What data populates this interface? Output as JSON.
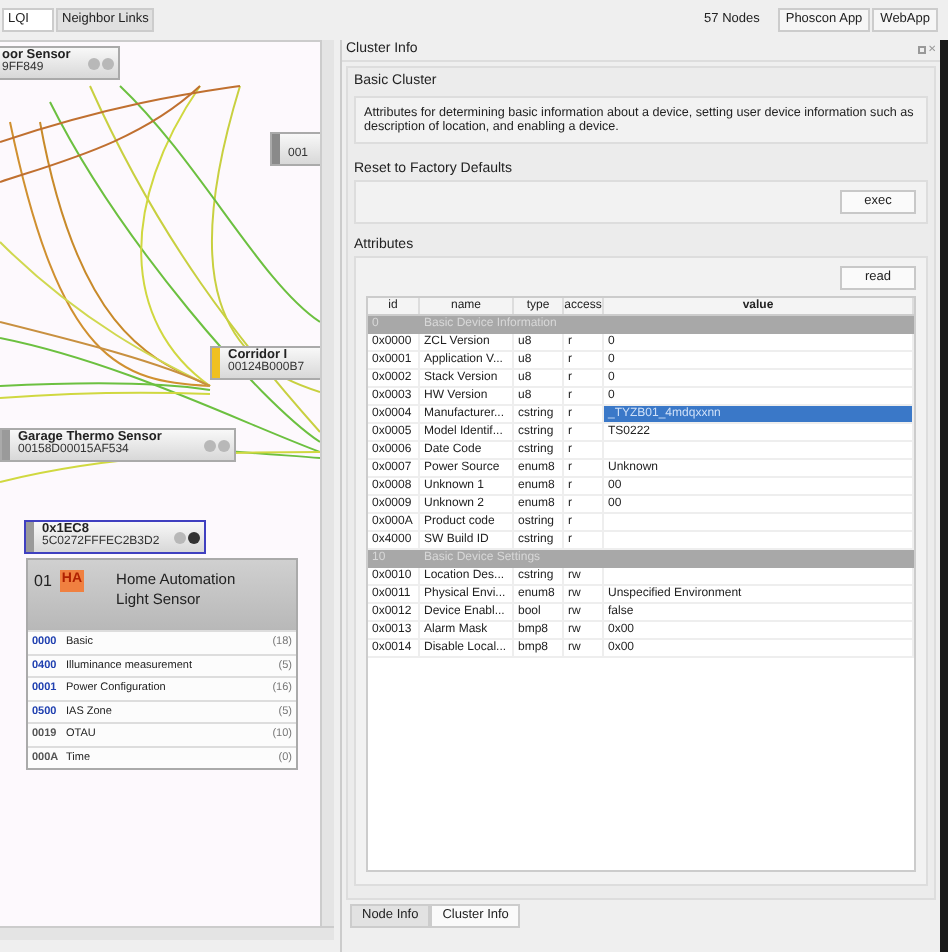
{
  "toolbar": {
    "lqi_dropdown": "LQI",
    "neighbor_links_button": "Neighbor Links",
    "node_count": "57 Nodes",
    "buttons": [
      "Phoscon App",
      "WebApp"
    ]
  },
  "canvas": {
    "nodes": [
      {
        "title": "oor Sensor",
        "address": "9FF849",
        "selected": false
      },
      {
        "address": "001",
        "selected": false,
        "color": "#8a8a8a"
      },
      {
        "title": "Corridor I",
        "address": "00124B000B7",
        "selected": false,
        "color": "#f0c020"
      },
      {
        "title": "Garage Thermo Sensor",
        "address": "00158D00015AF534",
        "selected": false,
        "color": "#9a9a9a"
      },
      {
        "title": "0x1EC8",
        "address": "5C0272FFFEC2B3D2",
        "selected": true,
        "color": "#9a9a9a"
      }
    ],
    "endpoint": {
      "number": "01",
      "profile": "HA",
      "title": "Home Automation",
      "subtitle": "Light Sensor",
      "clusters": [
        {
          "id": "0000",
          "name": "Basic",
          "count": "(18)",
          "color": "#2040b0"
        },
        {
          "id": "0400",
          "name": "Illuminance measurement",
          "count": "(5)",
          "color": "#2040b0"
        },
        {
          "id": "0001",
          "name": "Power Configuration",
          "count": "(16)",
          "color": "#2040b0"
        },
        {
          "id": "0500",
          "name": "IAS Zone",
          "count": "(5)",
          "color": "#2040b0"
        },
        {
          "id": "0019",
          "name": "OTAU",
          "count": "(10)",
          "color": "#555555"
        },
        {
          "id": "000A",
          "name": "Time",
          "count": "(0)",
          "color": "#555555"
        }
      ]
    }
  },
  "cluster_panel": {
    "title": "Cluster Info",
    "close_icon": "✕",
    "basic_cluster": {
      "title": "Basic Cluster",
      "description": "Attributes for determining basic information about a device, setting user device information such as description of location, and enabling a device."
    },
    "reset": {
      "title": "Reset to Factory Defaults",
      "button": "exec"
    },
    "attributes": {
      "title": "Attributes",
      "read_button": "read",
      "columns": [
        "id",
        "name",
        "type",
        "access",
        "value"
      ],
      "rows": [
        {
          "kind": "group",
          "id": "0",
          "name": "Basic Device Information"
        },
        {
          "kind": "attribute",
          "id": "0x0000",
          "name": "ZCL Version",
          "type": "u8",
          "access": "r",
          "value": "0",
          "selected": false
        },
        {
          "kind": "attribute",
          "id": "0x0001",
          "name": "Application V...",
          "type": "u8",
          "access": "r",
          "value": "0",
          "selected": false
        },
        {
          "kind": "attribute",
          "id": "0x0002",
          "name": "Stack Version",
          "type": "u8",
          "access": "r",
          "value": "0",
          "selected": false
        },
        {
          "kind": "attribute",
          "id": "0x0003",
          "name": "HW Version",
          "type": "u8",
          "access": "r",
          "value": "0",
          "selected": false
        },
        {
          "kind": "attribute",
          "id": "0x0004",
          "name": "Manufacturer...",
          "type": "cstring",
          "access": "r",
          "value": "_TYZB01_4mdqxxnn",
          "selected": true
        },
        {
          "kind": "attribute",
          "id": "0x0005",
          "name": "Model Identif...",
          "type": "cstring",
          "access": "r",
          "value": "TS0222",
          "selected": false
        },
        {
          "kind": "attribute",
          "id": "0x0006",
          "name": "Date Code",
          "type": "cstring",
          "access": "r",
          "selected": false
        },
        {
          "kind": "attribute",
          "id": "0x0007",
          "name": "Power Source",
          "type": "enum8",
          "access": "r",
          "value": "Unknown",
          "selected": false
        },
        {
          "kind": "attribute",
          "id": "0x0008",
          "name": "Unknown 1",
          "type": "enum8",
          "access": "r",
          "value": "00",
          "selected": false
        },
        {
          "kind": "attribute",
          "id": "0x0009",
          "name": "Unknown 2",
          "type": "enum8",
          "access": "r",
          "value": "00",
          "selected": false
        },
        {
          "kind": "attribute",
          "id": "0x000A",
          "name": "Product code",
          "type": "ostring",
          "access": "r",
          "selected": false
        },
        {
          "kind": "attribute",
          "id": "0x4000",
          "name": "SW Build ID",
          "type": "cstring",
          "access": "r",
          "selected": false
        },
        {
          "kind": "group",
          "id": "10",
          "name": "Basic Device Settings"
        },
        {
          "kind": "attribute",
          "id": "0x0010",
          "name": "Location Des...",
          "type": "cstring",
          "access": "rw",
          "selected": false
        },
        {
          "kind": "attribute",
          "id": "0x0011",
          "name": "Physical Envi...",
          "type": "enum8",
          "access": "rw",
          "value": "Unspecified Environment",
          "selected": false
        },
        {
          "kind": "attribute",
          "id": "0x0012",
          "name": "Device Enabl...",
          "type": "bool",
          "access": "rw",
          "value": "false",
          "selected": false
        },
        {
          "kind": "attribute",
          "id": "0x0013",
          "name": "Alarm Mask",
          "type": "bmp8",
          "access": "rw",
          "value": "0x00",
          "selected": false
        },
        {
          "kind": "attribute",
          "id": "0x0014",
          "name": "Disable Local...",
          "type": "bmp8",
          "access": "rw",
          "value": "0x00",
          "selected": false
        }
      ]
    }
  },
  "tabs": [
    {
      "label": "Node Info",
      "selected": false
    },
    {
      "label": "Cluster Info",
      "selected": true
    }
  ]
}
